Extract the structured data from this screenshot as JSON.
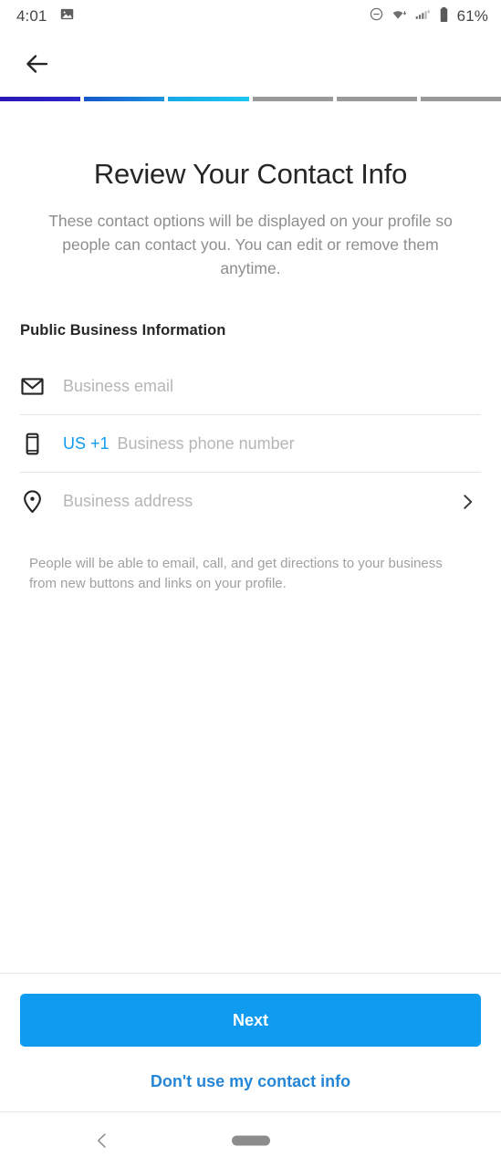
{
  "status_bar": {
    "time": "4:01",
    "battery_percent": "61%",
    "icons": {
      "notification": "image-icon",
      "dnd": "do-not-disturb-icon",
      "wifi": "wifi-icon",
      "signal": "cellular-signal-icon",
      "battery": "battery-icon"
    }
  },
  "topbar": {
    "back": "back-arrow-icon"
  },
  "progress": {
    "total_steps": 6,
    "completed_steps": 3,
    "segments": [
      {
        "state": "complete",
        "color_start": "#2a16b5",
        "color_end": "#2b26c9"
      },
      {
        "state": "complete",
        "color_start": "#1756c9",
        "color_end": "#1b93e2"
      },
      {
        "state": "complete",
        "color_start": "#18a8e6",
        "color_end": "#1cc6f2"
      },
      {
        "state": "incomplete",
        "color_start": "#9a9a9a",
        "color_end": "#9a9a9a"
      },
      {
        "state": "incomplete",
        "color_start": "#9a9a9a",
        "color_end": "#9a9a9a"
      },
      {
        "state": "incomplete",
        "color_start": "#9a9a9a",
        "color_end": "#9a9a9a"
      }
    ]
  },
  "main": {
    "title": "Review Your Contact Info",
    "subtitle": "These contact options will be displayed on your profile so people can contact you. You can edit or remove them anytime.",
    "section_header": "Public Business Information",
    "fields": [
      {
        "name": "business-email",
        "icon": "envelope-icon",
        "prefix": "",
        "placeholder": "Business email",
        "value": "",
        "has_chevron": false
      },
      {
        "name": "business-phone",
        "icon": "smartphone-icon",
        "prefix": "US +1",
        "placeholder": "Business phone number",
        "value": "",
        "has_chevron": false
      },
      {
        "name": "business-address",
        "icon": "location-pin-icon",
        "prefix": "",
        "placeholder": "Business address",
        "value": "",
        "has_chevron": true
      }
    ],
    "helper_text": "People will be able to email, call, and get directions to your business from new buttons and links on your profile."
  },
  "actions": {
    "primary_label": "Next",
    "secondary_label": "Don't use my contact info"
  },
  "nav_bar": {
    "back": "nav-back-chevron-icon",
    "home": "nav-home-pill"
  },
  "colors": {
    "accent_blue": "#0e9bf0",
    "link_blue": "#2686d6",
    "prefix_blue": "#0d9bef",
    "text_primary": "#262626",
    "text_muted": "#8e8e8e",
    "placeholder": "#b6b6b6",
    "divider": "#e4e4e4"
  }
}
